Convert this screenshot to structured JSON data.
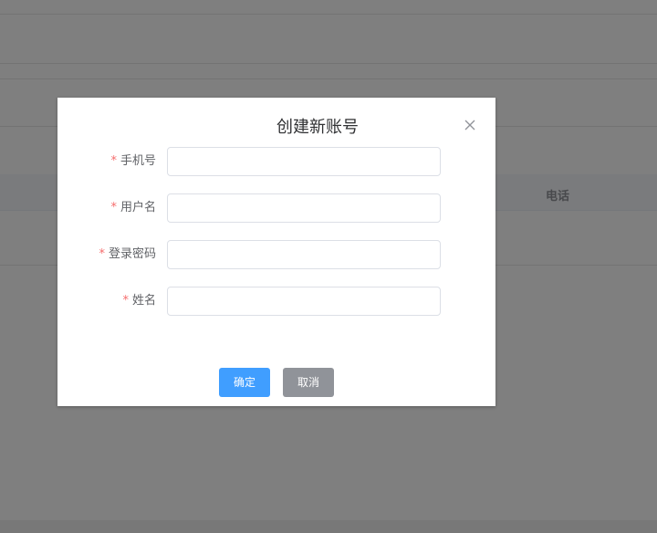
{
  "background": {
    "table_column_phone": "电话"
  },
  "dialog": {
    "title": "创建新账号",
    "close_icon": "close-icon",
    "fields": [
      {
        "label": "手机号",
        "required": "*",
        "value": "",
        "placeholder": ""
      },
      {
        "label": "用户名",
        "required": "*",
        "value": "",
        "placeholder": ""
      },
      {
        "label": "登录密码",
        "required": "*",
        "value": "",
        "placeholder": ""
      },
      {
        "label": "姓名",
        "required": "*",
        "value": "",
        "placeholder": ""
      }
    ],
    "confirm_label": "确定",
    "cancel_label": "取消"
  },
  "colors": {
    "primary": "#409eff",
    "cancel": "#909399",
    "required": "#f56c6c",
    "overlay": "rgba(0,0,0,0.5)"
  }
}
